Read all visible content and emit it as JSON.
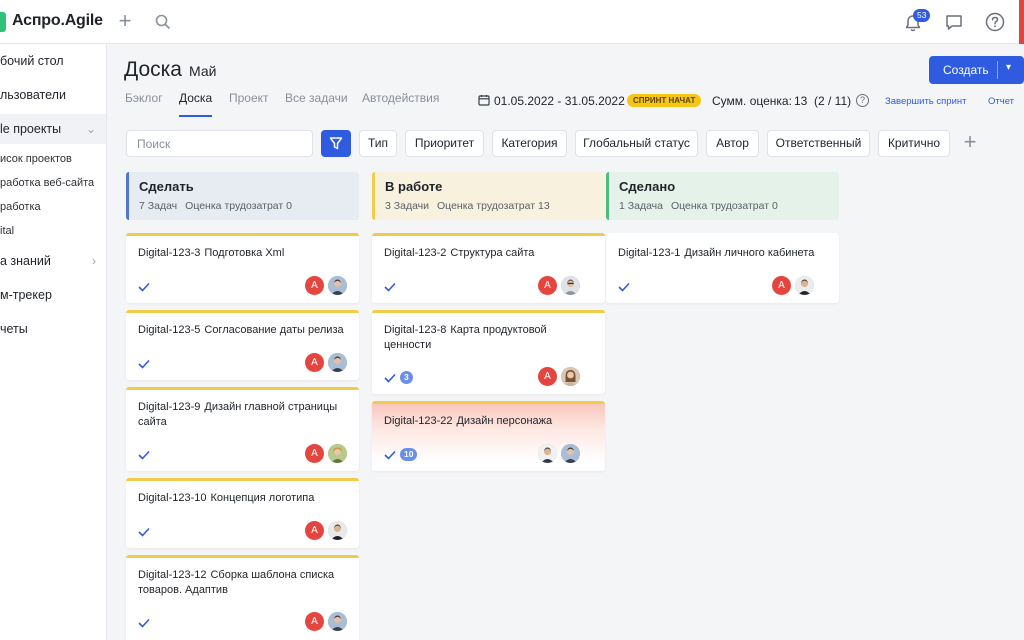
{
  "app": {
    "logo": "Аспро.Agile",
    "notifications": "53"
  },
  "sidebar": {
    "items": [
      {
        "label": "бочий стол"
      },
      {
        "label": "льзователи"
      },
      {
        "label": "le проекты"
      },
      {
        "label": "исок проектов"
      },
      {
        "label": "работка веб-сайта"
      },
      {
        "label": "работка"
      },
      {
        "label": "ital"
      },
      {
        "label": "а знаний"
      },
      {
        "label": "м-трекер"
      },
      {
        "label": "четы"
      }
    ]
  },
  "header": {
    "title": "Доска",
    "subtitle": "Май",
    "create_label": "Создать",
    "tabs": [
      "Бэклог",
      "Доска",
      "Проект",
      "Все задачи",
      "Автодействия"
    ],
    "dates": "01.05.2022 - 31.05.2022",
    "sprint_badge": "СПРИНТ НАЧАТ",
    "estimate_label": "Сумм. оценка:",
    "estimate_value": "13",
    "estimate_count": "(2 / 11)",
    "finish_link": "Завершить спринт",
    "report_link": "Отчет"
  },
  "filters": {
    "search_placeholder": "Поиск",
    "chips": [
      "Тип",
      "Приоритет",
      "Категория",
      "Глобальный статус",
      "Автор",
      "Ответственный",
      "Критично"
    ]
  },
  "columns": [
    {
      "title": "Сделать",
      "count": "7 Задач",
      "estimate": "Оценка трудозатрат 0",
      "bg": "#e7ebf2",
      "accent": "#4f78c9"
    },
    {
      "title": "В работе",
      "count": "3 Задачи",
      "estimate": "Оценка трудозатрат 13",
      "bg": "#f7f1de",
      "accent": "#f0cc4a"
    },
    {
      "title": "Сделано",
      "count": "1 Задача",
      "estimate": "Оценка трудозатрат 0",
      "bg": "#e4f2ea",
      "accent": "#4cba7e"
    }
  ],
  "cards": [
    {
      "key": "Digital-123-3",
      "title": "Подготовка Xml"
    },
    {
      "key": "Digital-123-5",
      "title": "Согласование даты релиза"
    },
    {
      "key": "Digital-123-9",
      "title": "Дизайн главной страницы сайта"
    },
    {
      "key": "Digital-123-10",
      "title": "Концепция логотипа"
    },
    {
      "key": "Digital-123-12",
      "title": "Сборка шаблона списка товаров. Адаптив"
    },
    {
      "key": "Digital-123-2",
      "title": "Структура сайта"
    },
    {
      "key": "Digital-123-8",
      "title": "Карта продуктовой ценности",
      "badge": "3"
    },
    {
      "key": "Digital-123-22",
      "title": "Дизайн персонажа",
      "badge": "10"
    },
    {
      "key": "Digital-123-1",
      "title": "Дизайн личного кабинета"
    }
  ],
  "avatar_letter": "A",
  "colors": {
    "accent": "#2f5be0",
    "avatar_red": "#e4463f",
    "card_top": "#f0cc4a"
  }
}
